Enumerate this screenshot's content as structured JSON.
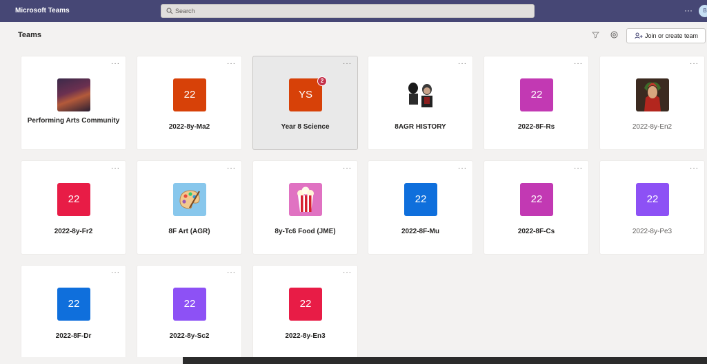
{
  "app": {
    "title": "Microsoft Teams"
  },
  "search": {
    "placeholder": "Search"
  },
  "header": {
    "more": "···",
    "avatar_initial": "B"
  },
  "page": {
    "title": "Teams",
    "join_label": "Join or create team"
  },
  "card_more": "···",
  "teams": [
    {
      "name": "Performing Arts Community",
      "tile_type": "image",
      "icon": "theatre-photo"
    },
    {
      "name": "2022-8y-Ma2",
      "tile_text": "22",
      "tile_color": "#d74108"
    },
    {
      "name": "Year 8 Science",
      "tile_text": "YS",
      "tile_color": "#d74108",
      "badge": "2",
      "selected": true
    },
    {
      "name": "8AGR HISTORY",
      "tile_type": "image",
      "icon": "history-figures-photo"
    },
    {
      "name": "2022-8F-Rs",
      "tile_text": "22",
      "tile_color": "#c239b3"
    },
    {
      "name": "2022-8y-En2",
      "tile_type": "image",
      "icon": "portrait-painting"
    },
    {
      "name": "2022-8y-Fr2",
      "tile_text": "22",
      "tile_color": "#e81c46"
    },
    {
      "name": "8F Art (AGR)",
      "tile_type": "image",
      "icon": "paint-palette-icon"
    },
    {
      "name": "8y-Tc6 Food (JME)",
      "tile_type": "image",
      "icon": "popcorn-icon"
    },
    {
      "name": "2022-8F-Mu",
      "tile_text": "22",
      "tile_color": "#0f6fdc"
    },
    {
      "name": "2022-8F-Cs",
      "tile_text": "22",
      "tile_color": "#c239b3"
    },
    {
      "name": "2022-8y-Pe3",
      "tile_text": "22",
      "tile_color": "#8d51f5"
    },
    {
      "name": "2022-8F-Dr",
      "tile_text": "22",
      "tile_color": "#0f6fdc"
    },
    {
      "name": "2022-8y-Sc2",
      "tile_text": "22",
      "tile_color": "#8d51f5"
    },
    {
      "name": "2022-8y-En3",
      "tile_text": "22",
      "tile_color": "#e81c46"
    }
  ]
}
